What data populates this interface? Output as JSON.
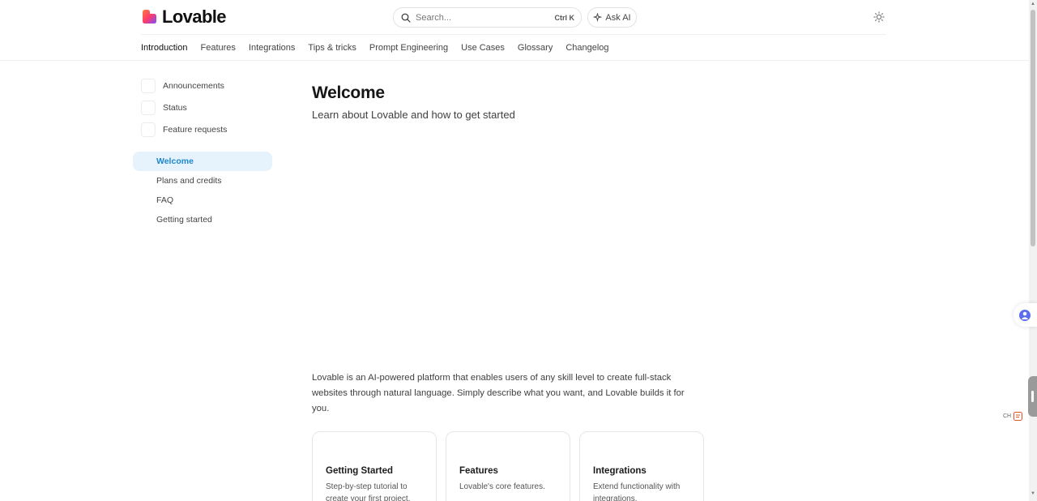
{
  "brand": {
    "name": "Lovable"
  },
  "header": {
    "search_placeholder": "Search...",
    "search_shortcut": "Ctrl K",
    "ask_ai_label": "Ask AI"
  },
  "tabs": [
    {
      "label": "Introduction",
      "active": true
    },
    {
      "label": "Features"
    },
    {
      "label": "Integrations"
    },
    {
      "label": "Tips & tricks"
    },
    {
      "label": "Prompt Engineering"
    },
    {
      "label": "Use Cases"
    },
    {
      "label": "Glossary"
    },
    {
      "label": "Changelog"
    }
  ],
  "sidebar": {
    "links": [
      {
        "label": "Announcements"
      },
      {
        "label": "Status"
      },
      {
        "label": "Feature requests"
      }
    ],
    "nav": [
      {
        "label": "Welcome",
        "active": true
      },
      {
        "label": "Plans and credits"
      },
      {
        "label": "FAQ"
      },
      {
        "label": "Getting started"
      }
    ]
  },
  "main": {
    "title": "Welcome",
    "subtitle": "Learn about Lovable and how to get started",
    "intro": "Lovable is an AI-powered platform that enables users of any skill level to create full-stack websites through natural language. Simply describe what you want, and Lovable builds it for you.",
    "cards": [
      {
        "title": "Getting Started",
        "description": "Step-by-step tutorial to create your first project."
      },
      {
        "title": "Features",
        "description": "Lovable's core features."
      },
      {
        "title": "Integrations",
        "description": "Extend functionality with integrations."
      }
    ]
  },
  "widgets": {
    "badge_text": "CH"
  },
  "colors": {
    "accent": "#2b93d6",
    "active_bg": "#e6f3fc",
    "active_text": "#1e86cc"
  }
}
